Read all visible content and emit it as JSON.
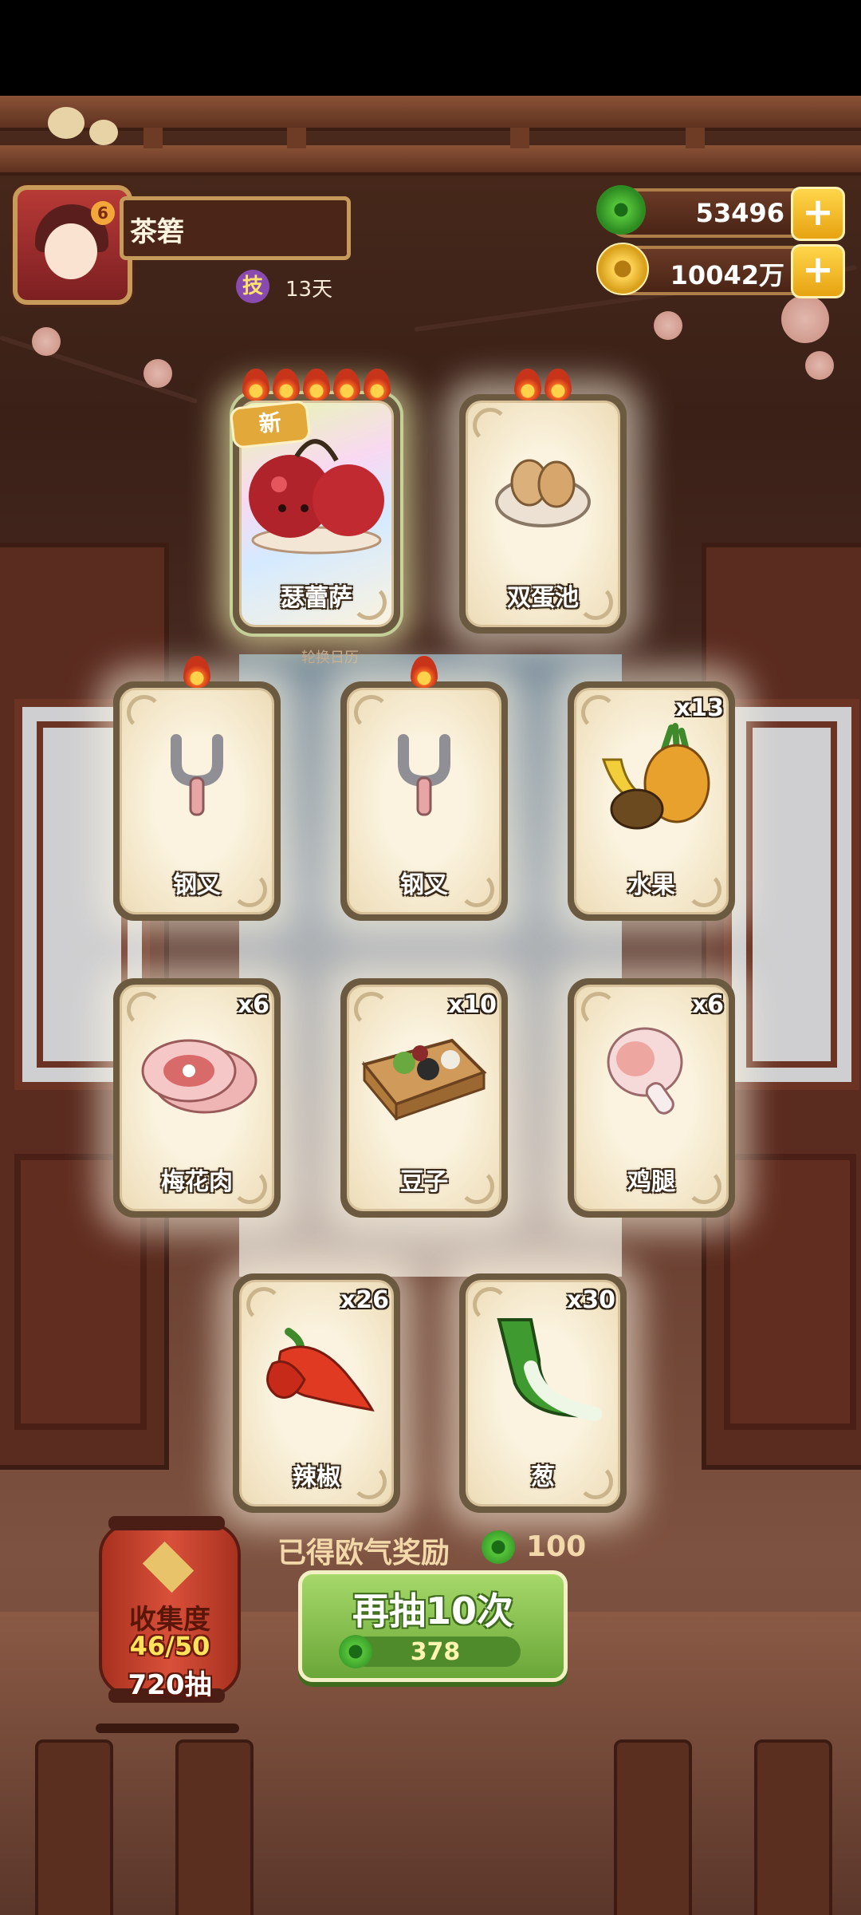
{
  "player": {
    "name": "茶箬",
    "skill_badge": "技",
    "days": "13天",
    "avatar_badge": "6"
  },
  "resources": [
    {
      "icon": "jade-coin-icon",
      "value": "53496",
      "plus": "+"
    },
    {
      "icon": "gold-coin-icon",
      "value": "10042万",
      "plus": "+"
    }
  ],
  "new_tag": "新",
  "calendar_caption": "轮换日历",
  "cards": [
    {
      "name": "瑟蕾萨",
      "qty": "",
      "flames": 5,
      "icon": "cherry-dish-icon",
      "rarity": "rainbow"
    },
    {
      "name": "双蛋池",
      "qty": "",
      "flames": 2,
      "icon": "egg-bowl-icon",
      "rarity": "normal"
    },
    {
      "name": "钢叉",
      "qty": "",
      "flames": 1,
      "icon": "fork-icon",
      "rarity": "normal"
    },
    {
      "name": "钢叉",
      "qty": "",
      "flames": 1,
      "icon": "fork-icon",
      "rarity": "normal"
    },
    {
      "name": "水果",
      "qty": "x13",
      "flames": 0,
      "icon": "fruit-icon",
      "rarity": "normal"
    },
    {
      "name": "梅花肉",
      "qty": "x6",
      "flames": 0,
      "icon": "pork-icon",
      "rarity": "normal"
    },
    {
      "name": "豆子",
      "qty": "x10",
      "flames": 0,
      "icon": "beans-icon",
      "rarity": "normal"
    },
    {
      "name": "鸡腿",
      "qty": "x6",
      "flames": 0,
      "icon": "drumstick-icon",
      "rarity": "normal"
    },
    {
      "name": "辣椒",
      "qty": "x26",
      "flames": 0,
      "icon": "chili-icon",
      "rarity": "normal"
    },
    {
      "name": "葱",
      "qty": "x30",
      "flames": 0,
      "icon": "scallion-icon",
      "rarity": "normal"
    }
  ],
  "reward": {
    "label": "已得欧气奖励",
    "value": "100"
  },
  "draw_button": {
    "label": "再抽10次",
    "cost": "378"
  },
  "collection": {
    "title": "收集度",
    "progress": "46/50",
    "pulls": "720抽"
  },
  "colors": {
    "accent_green": "#6aa738",
    "gold": "#e7a312",
    "wood": "#4b2517"
  }
}
